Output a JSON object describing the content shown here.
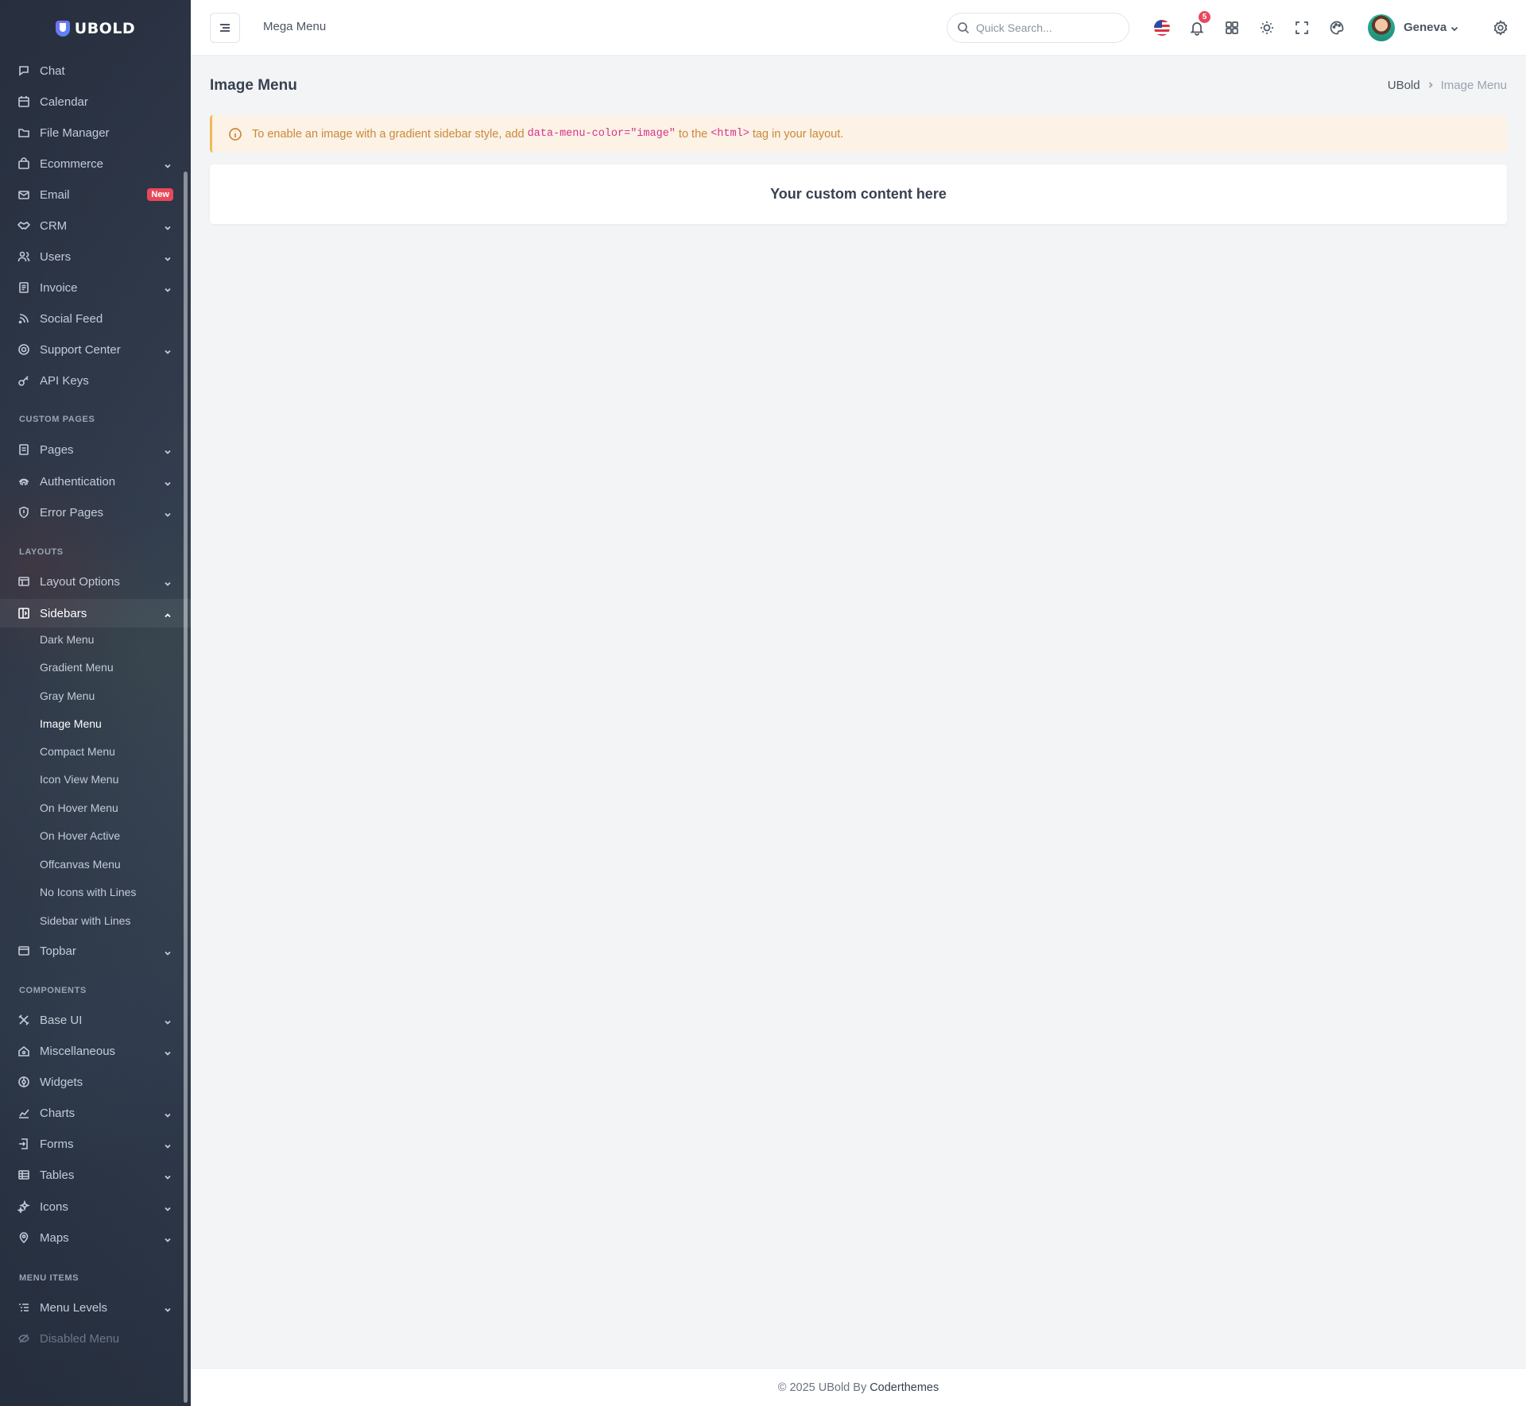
{
  "brand": {
    "name": "UBOLD"
  },
  "sidebar": {
    "items_top": [
      {
        "label": "Chat",
        "icon": "chat-icon"
      },
      {
        "label": "Calendar",
        "icon": "calendar-icon"
      },
      {
        "label": "File Manager",
        "icon": "folder-icon"
      },
      {
        "label": "Ecommerce",
        "icon": "shopping-bag-icon"
      },
      {
        "label": "Email",
        "icon": "mail-icon",
        "badge": "New"
      },
      {
        "label": "CRM",
        "icon": "handshake-icon"
      },
      {
        "label": "Users",
        "icon": "users-icon"
      },
      {
        "label": "Invoice",
        "icon": "invoice-icon"
      },
      {
        "label": "Social Feed",
        "icon": "rss-icon"
      },
      {
        "label": "Support Center",
        "icon": "lifebuoy-icon"
      },
      {
        "label": "API Keys",
        "icon": "key-icon"
      }
    ],
    "section_custom_pages": "CUSTOM PAGES",
    "items_custom": [
      {
        "label": "Pages",
        "icon": "file-icon"
      },
      {
        "label": "Authentication",
        "icon": "fingerprint-icon"
      },
      {
        "label": "Error Pages",
        "icon": "shield-icon"
      }
    ],
    "section_layouts": "LAYOUTS",
    "items_layouts": [
      {
        "label": "Layout Options",
        "icon": "layout-icon"
      },
      {
        "label": "Sidebars",
        "icon": "sidebar-icon"
      }
    ],
    "sidebars_sub": [
      "Dark Menu",
      "Gradient Menu",
      "Gray Menu",
      "Image Menu",
      "Compact Menu",
      "Icon View Menu",
      "On Hover Menu",
      "On Hover Active",
      "Offcanvas Menu",
      "No Icons with Lines",
      "Sidebar with Lines"
    ],
    "topbar_item": "Topbar",
    "section_components": "COMPONENTS",
    "items_components": [
      {
        "label": "Base UI",
        "icon": "tools-icon"
      },
      {
        "label": "Miscellaneous",
        "icon": "home-icon"
      },
      {
        "label": "Widgets",
        "icon": "widget-icon"
      },
      {
        "label": "Charts",
        "icon": "chart-icon"
      },
      {
        "label": "Forms",
        "icon": "form-icon"
      },
      {
        "label": "Tables",
        "icon": "table-icon"
      },
      {
        "label": "Icons",
        "icon": "sparkles-icon"
      },
      {
        "label": "Maps",
        "icon": "map-pin-icon"
      }
    ],
    "section_menu_items": "MENU ITEMS",
    "menu_levels": "Menu Levels",
    "disabled_menu": "Disabled Menu"
  },
  "topbar": {
    "mega_menu": "Mega Menu",
    "search_placeholder": "Quick Search...",
    "notification_count": "5",
    "user_name": "Geneva"
  },
  "page": {
    "title": "Image Menu",
    "breadcrumb_root": "UBold",
    "breadcrumb_current": "Image Menu"
  },
  "alert": {
    "text_before": "To enable an image with a gradient sidebar style, add",
    "code_attr": "data-menu-color=\"image\"",
    "text_middle": "to the",
    "code_tag": "<html>",
    "text_after": "tag in your layout."
  },
  "card": {
    "text": "Your custom content here"
  },
  "footer": {
    "copyright": "© 2025 UBold By",
    "brand": "Coderthemes"
  },
  "colors": {
    "sidebar_bg": "#2f3a4c",
    "page_bg": "#f3f4f6",
    "badge": "#e8485c",
    "alert_bg": "#fcf2e5",
    "alert_text": "#c9893a",
    "code_pink": "#d6338a"
  }
}
